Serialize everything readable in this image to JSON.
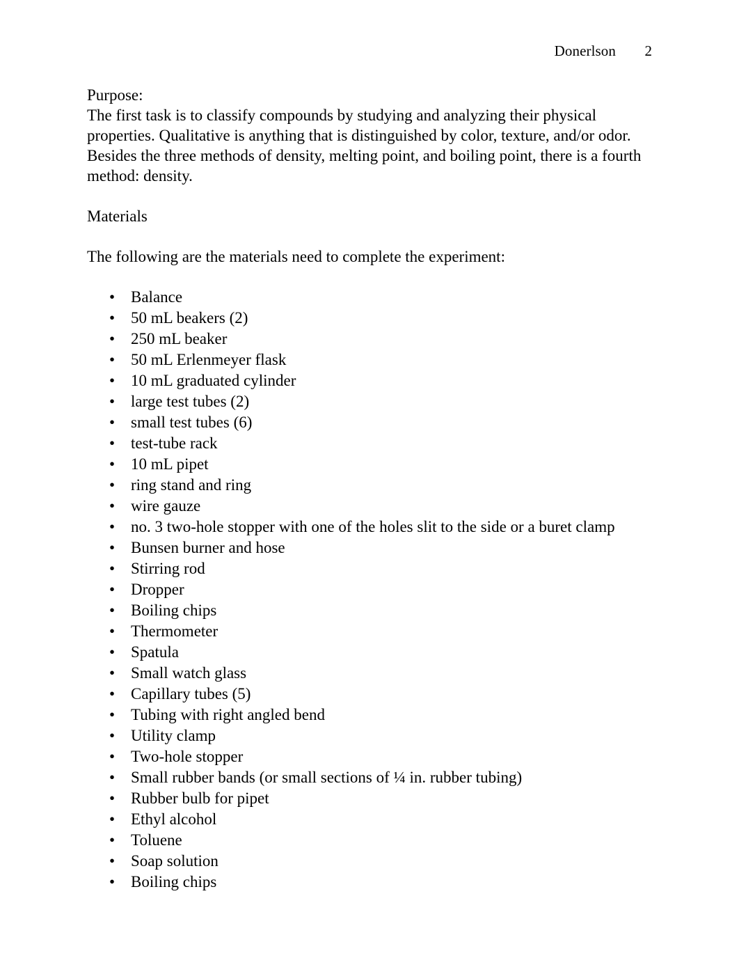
{
  "document": {
    "header": {
      "author_name": "Donerlson",
      "page_number": "2"
    },
    "purpose": {
      "label": "Purpose:",
      "text": "The first task is to classify compounds by studying and analyzing their physical properties. Qualitative is anything that is distinguished by color, texture, and/or odor. Besides the three methods of density, melting point, and boiling point, there is a fourth method: density."
    },
    "materials": {
      "heading": "Materials",
      "lead_in": "The following are the materials need to complete the experiment:",
      "bullet_glyph": "•",
      "items": [
        "Balance",
        "50 mL beakers (2)",
        "250 mL beaker",
        "50 mL Erlenmeyer flask",
        "10 mL graduated cylinder",
        "large test tubes (2)",
        "small test tubes (6)",
        "test-tube rack",
        "10 mL pipet",
        "ring stand and ring",
        "wire gauze",
        "no. 3 two-hole stopper with one of the holes slit to the side or a buret clamp",
        "Bunsen burner and hose",
        "Stirring rod",
        "Dropper",
        "Boiling chips",
        "Thermometer",
        "Spatula",
        "Small watch glass",
        "Capillary tubes (5)",
        "Tubing with right angled bend",
        "Utility clamp",
        "Two-hole stopper",
        "Small rubber bands (or small sections of ¼ in. rubber tubing)",
        "Rubber bulb for pipet",
        "Ethyl alcohol",
        "Toluene",
        "Soap solution",
        "Boiling chips"
      ]
    }
  }
}
